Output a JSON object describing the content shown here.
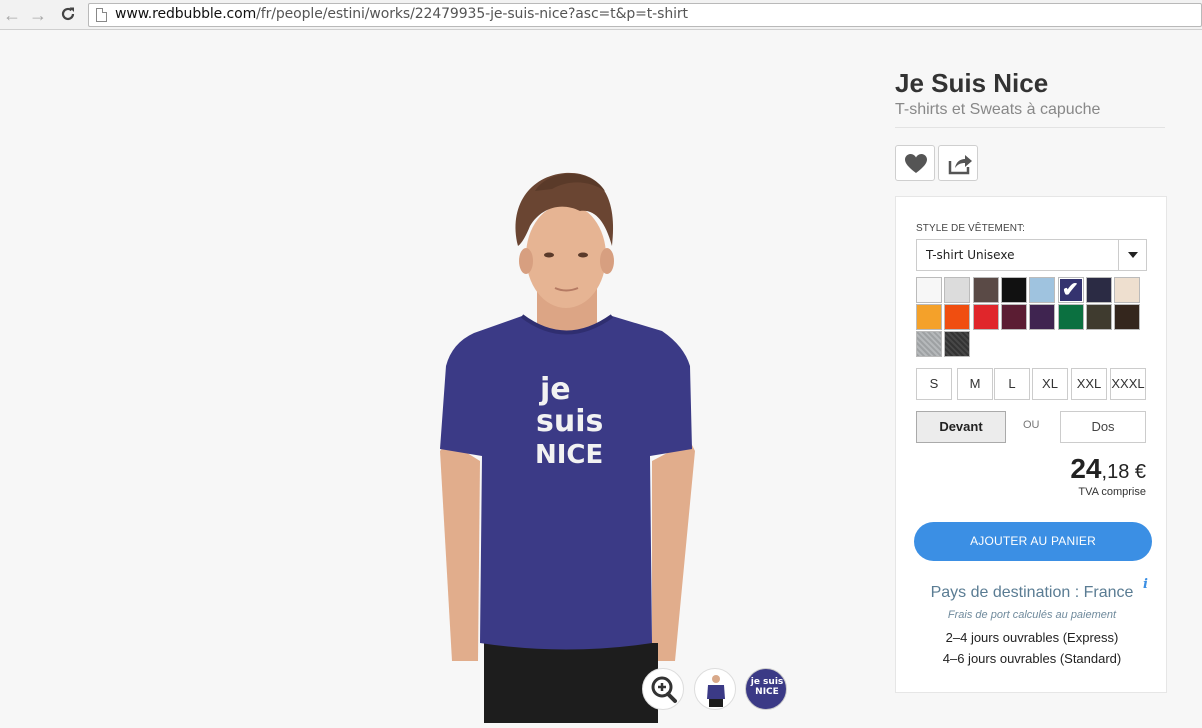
{
  "browser": {
    "url_host": "www.redbubble.com",
    "url_path": "/fr/people/estini/works/22479935-je-suis-nice?asc=t&p=t-shirt"
  },
  "product": {
    "title": "Je Suis Nice",
    "subtitle": "T-shirts et Sweats à capuche",
    "shirt_color": "#3b3a86",
    "print_text_lines": [
      "je",
      "suis",
      "NICE"
    ]
  },
  "actions": {
    "favorite_icon": "heart-icon",
    "share_icon": "share-icon"
  },
  "options": {
    "style_label": "STYLE DE VÊTEMENT:",
    "style_value": "T-shirt Unisexe",
    "colors": [
      {
        "hex": "#f7f7f7",
        "selected": false
      },
      {
        "hex": "#dcdcdc",
        "selected": false
      },
      {
        "hex": "#5a4a46",
        "selected": false
      },
      {
        "hex": "#111111",
        "selected": false
      },
      {
        "hex": "#9fc3df",
        "selected": false
      },
      {
        "hex": "#34336f",
        "selected": true
      },
      {
        "hex": "#2b2b44",
        "selected": false
      },
      {
        "hex": "#eedfcf",
        "selected": false
      },
      {
        "hex": "#f4a12a",
        "selected": false
      },
      {
        "hex": "#f04e10",
        "selected": false
      },
      {
        "hex": "#e0262b",
        "selected": false
      },
      {
        "hex": "#5b1d33",
        "selected": false
      },
      {
        "hex": "#3f2450",
        "selected": false
      },
      {
        "hex": "#0b7040",
        "selected": false
      },
      {
        "hex": "#3f3b2f",
        "selected": false
      },
      {
        "hex": "#34261d",
        "selected": false
      },
      {
        "hex": "#a9acae",
        "selected": false
      },
      {
        "hex": "#3c3c3c",
        "selected": false
      }
    ],
    "sizes": [
      "S",
      "M",
      "L",
      "XL",
      "XXL",
      "XXXL"
    ],
    "view_front": "Devant",
    "view_or": "OU",
    "view_back": "Dos"
  },
  "pricing": {
    "price_int": "24",
    "price_dec": ",18 €",
    "tax_note": "TVA comprise",
    "cart_label": "AJOUTER AU PANIER"
  },
  "shipping": {
    "destination": "Pays de destination : France",
    "info_icon": "info-icon",
    "note": "Frais de port calculés au paiement",
    "express": "2–4 jours ouvrables (Express)",
    "standard": "4–6 jours ouvrables (Standard)"
  },
  "gallery": {
    "zoom_icon": "zoom-in-icon",
    "thumb_design_text": "je suis NICE"
  }
}
